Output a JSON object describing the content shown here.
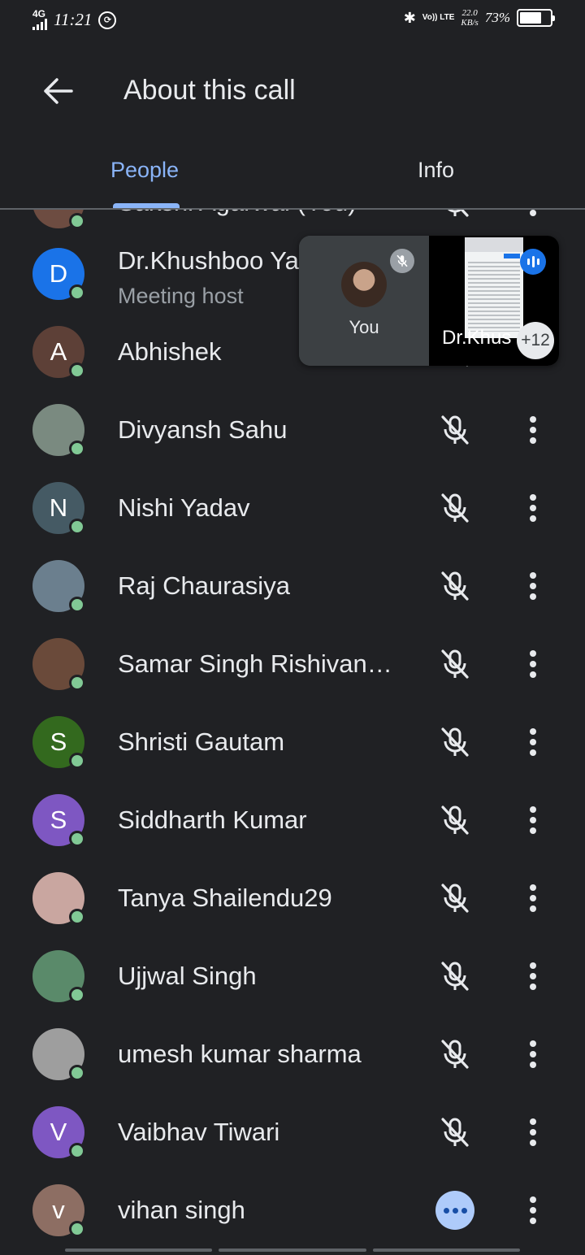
{
  "status_bar": {
    "network": "4G",
    "time": "11:21",
    "sync_icon": "circle-sync-icon",
    "volte": "Vo)) LTE",
    "speed_value": "22.0",
    "speed_unit": "KB/s",
    "battery": "73%",
    "battery_level": 0.73
  },
  "header": {
    "back_icon": "arrow-left-icon",
    "title": "About this call"
  },
  "tabs": [
    {
      "label": "People",
      "selected": true
    },
    {
      "label": "Info",
      "selected": false
    }
  ],
  "participants": [
    {
      "name": "Sakshi Agarwal (You)",
      "subtitle": "",
      "initial": "",
      "avatar_color": "#6d4c41",
      "mic": "off",
      "partial": true
    },
    {
      "name": "Dr.Khushboo Ya",
      "subtitle": "Meeting host",
      "initial": "D",
      "avatar_color": "#1a73e8",
      "mic": "off"
    },
    {
      "name": "Abhishek",
      "subtitle": "",
      "initial": "A",
      "avatar_color": "#5d4037",
      "mic": "off"
    },
    {
      "name": "Divyansh Sahu",
      "subtitle": "",
      "initial": "",
      "avatar_color": "#7a8a80",
      "mic": "off"
    },
    {
      "name": "Nishi Yadav",
      "subtitle": "",
      "initial": "N",
      "avatar_color": "#455a64",
      "mic": "off"
    },
    {
      "name": "Raj Chaurasiya",
      "subtitle": "",
      "initial": "",
      "avatar_color": "#6b7f8e",
      "mic": "off"
    },
    {
      "name": "Samar Singh Rishivan…",
      "subtitle": "",
      "initial": "",
      "avatar_color": "#6a4a3a",
      "mic": "off"
    },
    {
      "name": "Shristi Gautam",
      "subtitle": "",
      "initial": "S",
      "avatar_color": "#33691e",
      "mic": "off"
    },
    {
      "name": "Siddharth Kumar",
      "subtitle": "",
      "initial": "S",
      "avatar_color": "#7e57c2",
      "mic": "off"
    },
    {
      "name": "Tanya Shailendu29",
      "subtitle": "",
      "initial": "",
      "avatar_color": "#c9a6a0",
      "mic": "off"
    },
    {
      "name": "Ujjwal Singh",
      "subtitle": "",
      "initial": "",
      "avatar_color": "#5a8a6a",
      "mic": "off"
    },
    {
      "name": "umesh kumar sharma",
      "subtitle": "",
      "initial": "",
      "avatar_color": "#9e9e9e",
      "mic": "off"
    },
    {
      "name": "Vaibhav Tiwari",
      "subtitle": "",
      "initial": "V",
      "avatar_color": "#7e57c2",
      "mic": "off"
    },
    {
      "name": "vihan singh",
      "subtitle": "",
      "initial": "v",
      "avatar_color": "#8d6e63",
      "mic": "speaking"
    }
  ],
  "pip": {
    "self_label": "You",
    "host_label": "Dr.Khus",
    "more_count": "+12"
  },
  "colors": {
    "background": "#202124",
    "accent": "#8ab4f8",
    "online": "#81c995"
  }
}
